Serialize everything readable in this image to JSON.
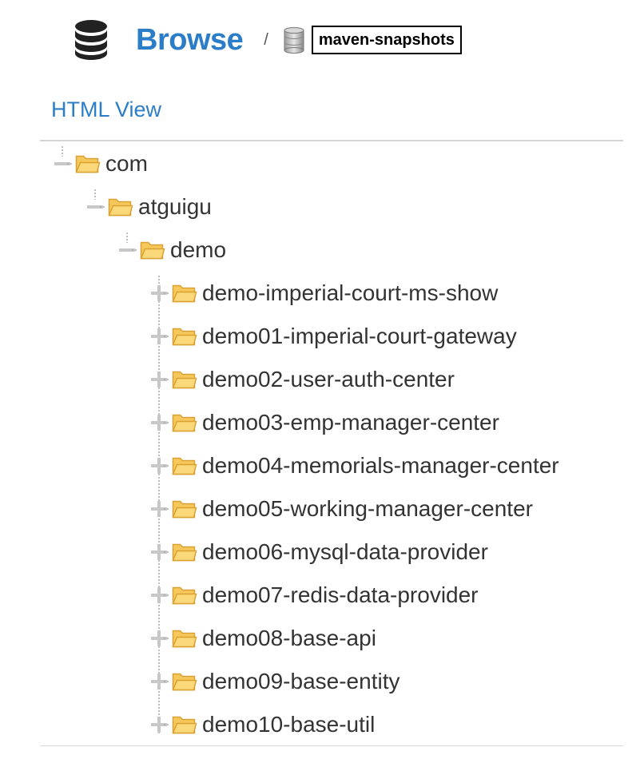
{
  "header": {
    "title": "Browse",
    "separator": "/",
    "repository": "maven-snapshots",
    "icon": "database-icon",
    "repository_icon": "database-small-icon"
  },
  "view_link": "HTML View",
  "colors": {
    "accent": "#2a7dc6",
    "folder_fill": "#f6c75a",
    "folder_stroke": "#d9a232"
  },
  "tree": {
    "root": {
      "label": "com",
      "state": "expanded"
    },
    "level2": {
      "label": "atguigu",
      "state": "expanded"
    },
    "level3": {
      "label": "demo",
      "state": "expanded"
    },
    "children": [
      {
        "label": "demo-imperial-court-ms-show",
        "state": "collapsed"
      },
      {
        "label": "demo01-imperial-court-gateway",
        "state": "collapsed"
      },
      {
        "label": "demo02-user-auth-center",
        "state": "collapsed"
      },
      {
        "label": "demo03-emp-manager-center",
        "state": "collapsed"
      },
      {
        "label": "demo04-memorials-manager-center",
        "state": "collapsed"
      },
      {
        "label": "demo05-working-manager-center",
        "state": "collapsed"
      },
      {
        "label": "demo06-mysql-data-provider",
        "state": "collapsed"
      },
      {
        "label": "demo07-redis-data-provider",
        "state": "collapsed"
      },
      {
        "label": "demo08-base-api",
        "state": "collapsed"
      },
      {
        "label": "demo09-base-entity",
        "state": "collapsed"
      },
      {
        "label": "demo10-base-util",
        "state": "collapsed"
      }
    ]
  }
}
